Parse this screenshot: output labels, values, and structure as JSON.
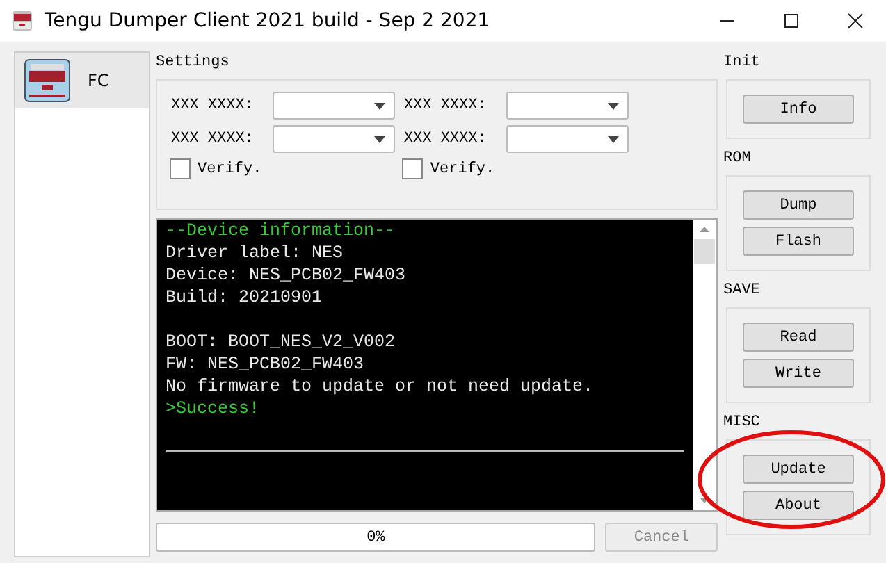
{
  "window": {
    "title": "Tengu Dumper Client 2021 build - Sep  2 2021"
  },
  "sidebar": {
    "items": [
      {
        "label": "FC",
        "selected": true
      }
    ]
  },
  "settings": {
    "title": "Settings",
    "columns": [
      {
        "fields": [
          {
            "label": "XXX XXXX:"
          },
          {
            "label": "XXX XXXX:"
          }
        ],
        "checkbox": {
          "label": "Verify.",
          "checked": false
        }
      },
      {
        "fields": [
          {
            "label": "XXX XXXX:"
          },
          {
            "label": "XXX XXXX:"
          }
        ],
        "checkbox": {
          "label": "Verify.",
          "checked": false
        }
      }
    ]
  },
  "log": {
    "lines": [
      {
        "text": "--Device information--",
        "kind": "status"
      },
      {
        "text": "Driver label: NES",
        "kind": "output"
      },
      {
        "text": "Device: NES_PCB02_FW403",
        "kind": "output"
      },
      {
        "text": "Build: 20210901",
        "kind": "output"
      },
      {
        "kind": "blank"
      },
      {
        "text": "BOOT: BOOT_NES_V2_V002",
        "kind": "output"
      },
      {
        "text": "FW: NES_PCB02_FW403",
        "kind": "output"
      },
      {
        "text": "No firmware to update or not need update.",
        "kind": "output"
      },
      {
        "text": ">Success!",
        "kind": "status"
      }
    ]
  },
  "progress": {
    "level": 0,
    "text": "0%"
  },
  "cancel_button": {
    "label": "Cancel",
    "disabled": true
  },
  "groups": [
    {
      "title": "Init",
      "buttons": [
        "Info"
      ]
    },
    {
      "title": "ROM",
      "buttons": [
        "Dump",
        "Flash"
      ]
    },
    {
      "title": "SAVE",
      "buttons": [
        "Read",
        "Write"
      ]
    },
    {
      "title": "MISC",
      "buttons": [
        "Update",
        "About"
      ]
    }
  ]
}
